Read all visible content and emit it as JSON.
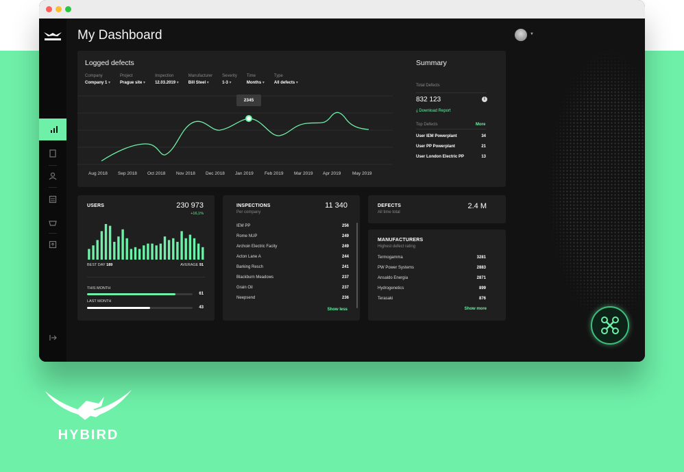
{
  "header": {
    "title": "My Dashboard"
  },
  "logged_defects": {
    "title": "Logged defects",
    "filters": [
      {
        "label": "Company",
        "value": "Company 1"
      },
      {
        "label": "Project",
        "value": "Prague site"
      },
      {
        "label": "Inspection",
        "value": "12.03.2019"
      },
      {
        "label": "Manufacturer",
        "value": "Bill Steel"
      },
      {
        "label": "Severity",
        "value": "1-3"
      },
      {
        "label": "Time",
        "value": "Months"
      },
      {
        "label": "Type",
        "value": "All defects"
      }
    ],
    "tooltip": "2345",
    "x_ticks": [
      "Aug 2018",
      "Sep 2018",
      "Oct 2018",
      "Nov 2018",
      "Dec 2018",
      "Jan 2019",
      "Feb 2019",
      "Mar 2019",
      "Apr 2019",
      "May 2019"
    ]
  },
  "summary": {
    "title": "Summary",
    "total_label": "Total Defects",
    "total_value": "832 123",
    "download_label": "⤓ Download Report",
    "top_label": "Top Defects",
    "more_label": "More",
    "top": [
      {
        "name": "User IEM Powerplant",
        "value": "34"
      },
      {
        "name": "User PP Powerplant",
        "value": "21"
      },
      {
        "name": "User London Electric PP",
        "value": "13"
      }
    ]
  },
  "users": {
    "title": "USERS",
    "value": "230 973",
    "change": "+16,1%",
    "best_day_label": "BEST DAY",
    "best_day_value": "189",
    "average_label": "AVERAGE",
    "average_value": "91",
    "bars": [
      0.3,
      0.4,
      0.55,
      0.8,
      1.0,
      0.95,
      0.5,
      0.65,
      0.85,
      0.6,
      0.3,
      0.35,
      0.3,
      0.4,
      0.45,
      0.45,
      0.4,
      0.45,
      0.65,
      0.55,
      0.6,
      0.5,
      0.8,
      0.6,
      0.7,
      0.6,
      0.45,
      0.35
    ],
    "this_month_label": "THIS MONTH",
    "this_month_value": "61",
    "this_month_fill": 0.84,
    "last_month_label": "LAST MONTH",
    "last_month_value": "43",
    "last_month_fill": 0.6
  },
  "inspections": {
    "title": "INSPECTIONS",
    "subtitle": "Per company",
    "value": "11 340",
    "rows": [
      {
        "name": "IEM PP",
        "value": "256"
      },
      {
        "name": "Rome NUP",
        "value": "249"
      },
      {
        "name": "Archoin Electric Facity",
        "value": "249"
      },
      {
        "name": "Acton Lane A",
        "value": "244"
      },
      {
        "name": "Barking Resch",
        "value": "241"
      },
      {
        "name": "Blackburn Meadows",
        "value": "237"
      },
      {
        "name": "Grain Oil",
        "value": "237"
      },
      {
        "name": "Neepsend",
        "value": "236"
      }
    ],
    "show_less": "Show less"
  },
  "defects": {
    "title": "DEFECTS",
    "subtitle": "All time total",
    "value": "2.4 M"
  },
  "manufacturers": {
    "title": "MANUFACTURERS",
    "subtitle": "Highest defect rating",
    "rows": [
      {
        "name": "Termogamma",
        "value": "3281"
      },
      {
        "name": "PW Power Systems",
        "value": "2883"
      },
      {
        "name": "Ansaldo Energia",
        "value": "2871"
      },
      {
        "name": "Hydrogenetics",
        "value": "899"
      },
      {
        "name": "Terasaki",
        "value": "876"
      }
    ],
    "show_more": "Show more"
  },
  "brand": {
    "name": "HYBIRD"
  },
  "colors": {
    "accent": "#6ef0a8",
    "panel": "#1f1f1f",
    "background": "#121212"
  }
}
